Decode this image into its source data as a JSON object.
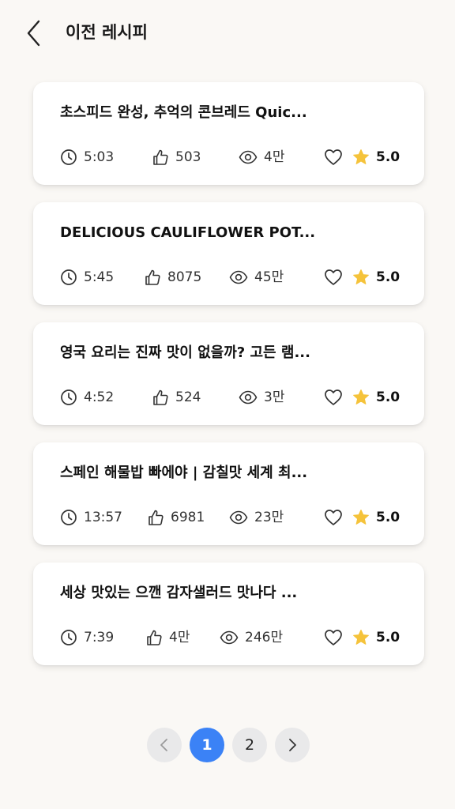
{
  "header": {
    "title": "이전 레시피"
  },
  "colors": {
    "accent": "#3b82f6",
    "star": "#f5c33b",
    "background": "#faf8f5"
  },
  "recipes": [
    {
      "title": "초스피드 완성, 추억의 콘브레드 Quic...",
      "duration": "5:03",
      "likes": "503",
      "views": "4만",
      "rating": "5.0"
    },
    {
      "title": "DELICIOUS CAULIFLOWER POT...",
      "duration": "5:45",
      "likes": "8075",
      "views": "45만",
      "rating": "5.0"
    },
    {
      "title": "영국 요리는 진짜 맛이 없을까? 고든 램...",
      "duration": "4:52",
      "likes": "524",
      "views": "3만",
      "rating": "5.0"
    },
    {
      "title": "스페인 해물밥 빠에야 | 감칠맛 세계 최...",
      "duration": "13:57",
      "likes": "6981",
      "views": "23만",
      "rating": "5.0"
    },
    {
      "title": "세상 맛있는 으깬 감자샐러드 맛나다 ...",
      "duration": "7:39",
      "likes": "4만",
      "views": "246만",
      "rating": "5.0"
    }
  ],
  "pagination": {
    "prev_icon": "chevron-left-icon",
    "pages": [
      "1",
      "2"
    ],
    "current": "1",
    "next_icon": "chevron-right-icon"
  }
}
